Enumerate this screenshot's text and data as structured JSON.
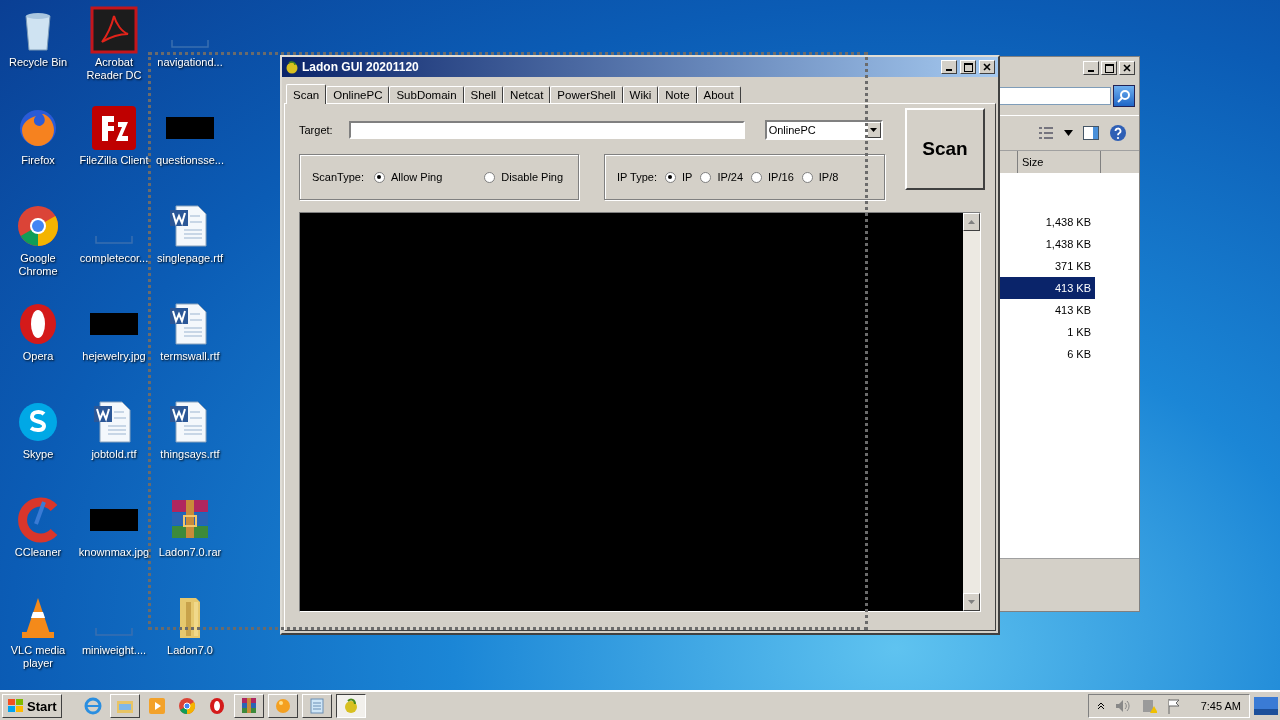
{
  "desktop_icons": [
    {
      "label": "Recycle Bin",
      "kind": "recycle"
    },
    {
      "label": "Firefox",
      "kind": "firefox"
    },
    {
      "label": "Google Chrome",
      "kind": "chrome"
    },
    {
      "label": "Opera",
      "kind": "opera"
    },
    {
      "label": "Skype",
      "kind": "skype"
    },
    {
      "label": "CCleaner",
      "kind": "ccleaner"
    },
    {
      "label": "VLC media player",
      "kind": "vlc"
    },
    {
      "label": "Acrobat Reader DC",
      "kind": "acrobat"
    },
    {
      "label": "FileZilla Client",
      "kind": "filezilla"
    },
    {
      "label": "completecor...",
      "kind": "blank"
    },
    {
      "label": "hejewelry.jpg",
      "kind": "image"
    },
    {
      "label": "jobtold.rtf",
      "kind": "doc"
    },
    {
      "label": "knownmax.jpg",
      "kind": "image"
    },
    {
      "label": "miniweight....",
      "kind": "blank"
    },
    {
      "label": "navigationd...",
      "kind": "blank"
    },
    {
      "label": "questionsse...",
      "kind": "image"
    },
    {
      "label": "singlepage.rtf",
      "kind": "doc"
    },
    {
      "label": "termswall.rtf",
      "kind": "doc"
    },
    {
      "label": "thingsays.rtf",
      "kind": "doc"
    },
    {
      "label": "Ladon7.0.rar",
      "kind": "rar"
    },
    {
      "label": "Ladon7.0",
      "kind": "folder"
    }
  ],
  "explorer_window": {
    "columns": [
      "Size"
    ],
    "rows": [
      {
        "size": "1,438 KB",
        "selected": false
      },
      {
        "size": "1,438 KB",
        "selected": false
      },
      {
        "size": "371 KB",
        "selected": false
      },
      {
        "size": "413 KB",
        "selected": true
      },
      {
        "size": "413 KB",
        "selected": false
      },
      {
        "size": "1 KB",
        "selected": false
      },
      {
        "size": "6 KB",
        "selected": false
      }
    ]
  },
  "window": {
    "title": "Ladon GUI 20201120"
  },
  "tabs": [
    {
      "label": "Scan",
      "selected": true
    },
    {
      "label": "OnlinePC",
      "selected": false
    },
    {
      "label": "SubDomain",
      "selected": false
    },
    {
      "label": "Shell",
      "selected": false
    },
    {
      "label": "Netcat",
      "selected": false
    },
    {
      "label": "PowerShell",
      "selected": false
    },
    {
      "label": "Wiki",
      "selected": false
    },
    {
      "label": "Note",
      "selected": false
    },
    {
      "label": "About",
      "selected": false
    }
  ],
  "target": {
    "label": "Target:"
  },
  "module_select": {
    "value": "OnlinePC"
  },
  "scan_button": "Scan",
  "scan_type": {
    "label": "ScanType:",
    "options": [
      {
        "label": "Allow Ping",
        "selected": true
      },
      {
        "label": "Disable Ping",
        "selected": false
      }
    ]
  },
  "ip_type": {
    "label": "IP Type:",
    "options": [
      {
        "label": "IP",
        "selected": true
      },
      {
        "label": "IP/24",
        "selected": false
      },
      {
        "label": "IP/16",
        "selected": false
      },
      {
        "label": "IP/8",
        "selected": false
      }
    ]
  },
  "taskbar": {
    "start": "Start",
    "tasks": [
      {
        "kind": "ie",
        "selected": false
      },
      {
        "kind": "explorer",
        "selected": false
      },
      {
        "kind": "media",
        "selected": false
      },
      {
        "kind": "chrome",
        "selected": false
      },
      {
        "kind": "opera",
        "selected": false
      },
      {
        "kind": "rar",
        "selected": false
      },
      {
        "kind": "orb",
        "selected": false
      },
      {
        "kind": "notepad",
        "selected": false
      },
      {
        "kind": "ladon",
        "selected": true
      }
    ],
    "clock": "7:45 AM"
  }
}
